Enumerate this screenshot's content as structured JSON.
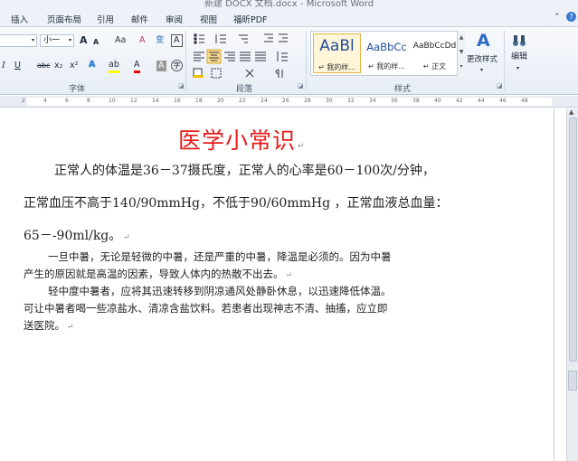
{
  "window": {
    "title": "新建 DOCX 文档.docx - Microsoft Word"
  },
  "tabs": [
    {
      "label": "插入"
    },
    {
      "label": "页面布局"
    },
    {
      "label": "引用"
    },
    {
      "label": "邮件"
    },
    {
      "label": "审阅"
    },
    {
      "label": "视图"
    },
    {
      "label": "福昕PDF"
    }
  ],
  "tab_controls": {
    "minimize_ribbon": "⌃",
    "help": "?"
  },
  "ribbon": {
    "font": {
      "size_value": "小一",
      "grow_font": "A",
      "shrink_font": "A",
      "change_case": "Aa",
      "clear_format": "A",
      "phonetic": "变",
      "char_border": "A",
      "italic": "I",
      "underline": "U",
      "strike": "abc",
      "subscript": "x₂",
      "superscript": "x²",
      "text_effect": "A",
      "highlight": "ab",
      "font_color": "A",
      "char_shading": "A",
      "enclose": "字",
      "group_label": "字体"
    },
    "paragraph": {
      "group_label": "段落"
    },
    "styles": {
      "items": [
        {
          "sample": "AaBl",
          "name": "↵ 我的样..."
        },
        {
          "sample": "AaBbCc",
          "name": "↵ 我的样..."
        },
        {
          "sample": "AaBbCcDd",
          "name": "↵ 正文"
        }
      ],
      "change_styles_label": "更改样式",
      "group_label": "样式"
    },
    "editing": {
      "label": "编辑"
    }
  },
  "ruler": {
    "ticks": [
      "2",
      "4",
      "6",
      "8",
      "10",
      "12",
      "14",
      "16",
      "18",
      "20",
      "22",
      "24",
      "26",
      "28",
      "30",
      "32",
      "34",
      "36",
      "38",
      "40",
      "42",
      "44",
      "46",
      "48"
    ]
  },
  "document": {
    "title": "医学小常识",
    "lines": [
      "正常人的体温是36－37摄氏度，正常人的心率是60－100次/分钟，",
      "正常血压不高于140/90mmHg，不低于90/60mmHg ，正常血液总血量：",
      "65－-90ml/kg。",
      "一旦中暑，无论是轻微的中暑，还是严重的中暑，降温是必须的。因为中暑",
      "产生的原因就是高温的因素，导致人体内的热散不出去。",
      "轻中度中暑者，应将其迅速转移到阴凉通风处静卧休息，以迅速降低体温。",
      "可让中暑者喝一些凉盐水、清凉含盐饮料。若患者出现神志不清、抽搐，应立即",
      "送医院。"
    ],
    "paragraph_mark": "↵"
  },
  "colors": {
    "title_red": "#e81a1a",
    "ribbon_bg": "#e7edf5",
    "selection": "#f7d98c"
  }
}
